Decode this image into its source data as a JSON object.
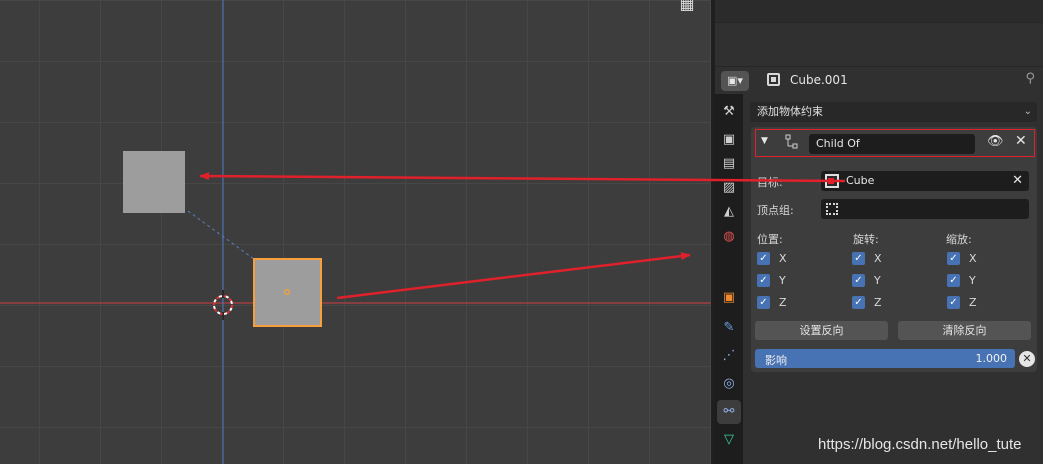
{
  "viewport": {
    "grid_icon": "grid-icon"
  },
  "properties": {
    "editor_type_icon": "▣▾",
    "object_name": "Cube.001",
    "pin_icon": "📌",
    "add_constraint": "添加物体约束",
    "tabs": [
      {
        "name": "tool-tab",
        "glyph": "🔧"
      },
      {
        "name": "render-tab",
        "glyph": "📷"
      },
      {
        "name": "output-tab",
        "glyph": "🖨"
      },
      {
        "name": "view-layer-tab",
        "glyph": "🖼"
      },
      {
        "name": "scene-tab",
        "glyph": "🎭"
      },
      {
        "name": "world-tab",
        "glyph": "🌐"
      },
      {
        "name": "object-tab",
        "glyph": "■"
      },
      {
        "name": "modifier-tab",
        "glyph": "🔧"
      },
      {
        "name": "particles-tab",
        "glyph": "✦"
      },
      {
        "name": "physics-tab",
        "glyph": "◉"
      },
      {
        "name": "constraints-tab",
        "glyph": "⚙"
      },
      {
        "name": "data-tab",
        "glyph": "▽"
      }
    ],
    "constraint": {
      "name": "Child Of",
      "target_label": "目标:",
      "target_value": "Cube",
      "vertex_group_label": "顶点组:",
      "location_label": "位置:",
      "rotation_label": "旋转:",
      "scale_label": "缩放:",
      "axes": [
        "X",
        "Y",
        "Z"
      ],
      "set_inverse": "设置反向",
      "clear_inverse": "清除反向",
      "influence_label": "影响",
      "influence_value": "1.000"
    }
  },
  "colors": {
    "accent": "#4772b3",
    "highlight": "#e0202a",
    "selection": "#f5a03c"
  },
  "watermark": "https://blog.csdn.net/hello_tute"
}
